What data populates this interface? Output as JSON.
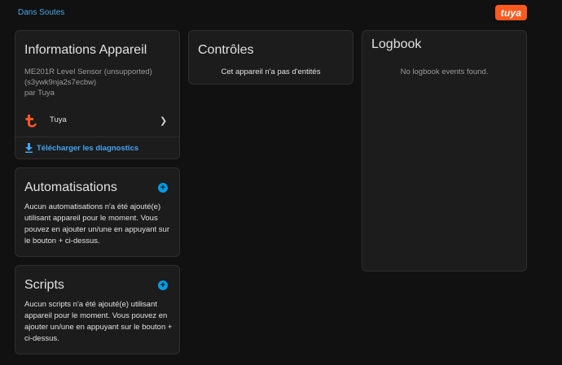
{
  "breadcrumb": "Dans Soutes",
  "brand_logo": "tuya",
  "device_info": {
    "title": "Informations Appareil",
    "model_line": "ME201R Level Sensor (unsupported)",
    "id_line": "(s3ywk9nja2s7ecbw)",
    "manufacturer_line": "par Tuya",
    "integration_label": "Tuya",
    "integration_icon": "tuya-icon",
    "download_label": "Télécharger les diagnostics",
    "download_icon": "download-icon"
  },
  "automations": {
    "title": "Automatisations",
    "empty_text": "Aucun automatisations n'a été ajouté(e) utilisant appareil pour le moment. Vous pouvez en ajouter un/une en appuyant sur le bouton + ci-dessus.",
    "add_symbol": "+"
  },
  "scripts": {
    "title": "Scripts",
    "empty_text": "Aucun scripts n'a été ajouté(e) utilisant appareil pour le moment. Vous pouvez en ajouter un/une en appuyant sur le bouton + ci-dessus.",
    "add_symbol": "+"
  },
  "controls": {
    "title": "Contrôles",
    "empty_text": "Cet appareil n'a pas d'entités"
  },
  "logbook": {
    "title": "Logbook",
    "empty_text": "No logbook events found."
  },
  "colors": {
    "background": "#111111",
    "card": "#1c1c1c",
    "accent": "#039be5",
    "link": "#42a5f5",
    "brand": "#ff5a1f"
  }
}
